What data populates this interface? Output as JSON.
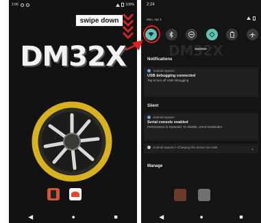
{
  "left_screen": {
    "status": {
      "time": "2:00",
      "battery": "100%"
    },
    "callout": "swipe down",
    "wallpaper_title": "DM32X",
    "nav": {
      "back": "◀",
      "home": "●",
      "recents": "■"
    }
  },
  "right_screen": {
    "status": {
      "time": "2:24"
    },
    "date": "Mon, Apr 4",
    "ghost_title": "DM32X",
    "quick_tiles": [
      "wifi-icon",
      "bluetooth-icon",
      "dnd-icon",
      "rotate-icon",
      "battery-saver-icon",
      "airplane-icon"
    ],
    "sections": {
      "notifications": "Notifications",
      "silent": "Silent",
      "manage": "Manage"
    },
    "notifications": [
      {
        "app": "Android System",
        "title": "USB debugging connected",
        "body": "Tap to turn off USB debugging"
      },
      {
        "app": "Android System",
        "title": "Serial console enabled",
        "body": "Performance is impacted. To disable, check bootloader."
      },
      {
        "app": "Android System • Charging this device via USB",
        "title": "",
        "body": ""
      }
    ],
    "nav": {
      "back": "◀",
      "home": "●",
      "recents": "■"
    }
  },
  "colors": {
    "highlight_red": "#e0221f",
    "tile_active": "#63c2b4",
    "fan_yellow": "#d8b21e"
  }
}
